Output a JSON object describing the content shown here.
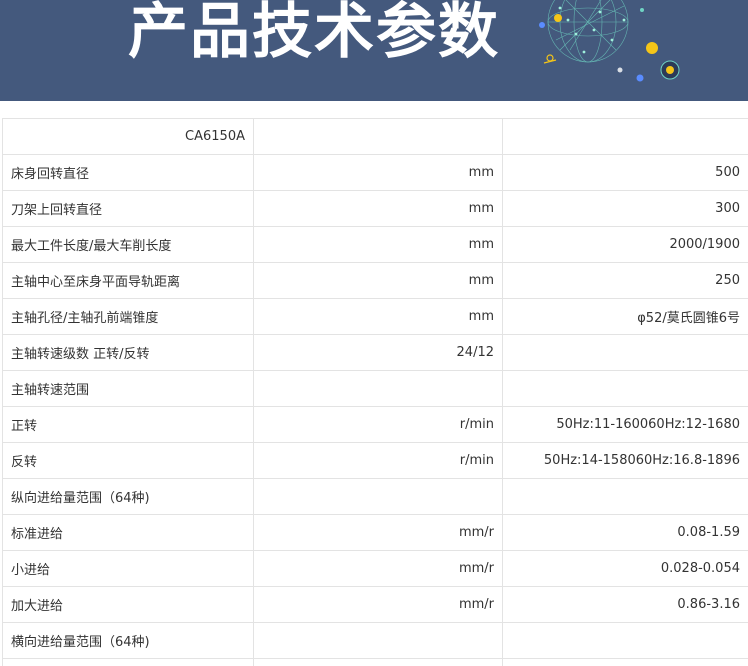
{
  "banner": {
    "title": "产品技术参数",
    "background": "#44597d"
  },
  "spec_table": {
    "rows": [
      {
        "name": "CA6150A",
        "unit": "",
        "value": ""
      },
      {
        "name": "床身回转直径",
        "unit": "mm",
        "value": "500"
      },
      {
        "name": "刀架上回转直径",
        "unit": "mm",
        "value": "300"
      },
      {
        "name": "最大工件长度/最大车削长度",
        "unit": "mm",
        "value": "2000/1900"
      },
      {
        "name": "主轴中心至床身平面导轨距离",
        "unit": "mm",
        "value": "250"
      },
      {
        "name": "主轴孔径/主轴孔前端锥度",
        "unit": "mm",
        "value": "φ52/莫氏圆锥6号"
      },
      {
        "name": "主轴转速级数 正转/反转",
        "unit": "24/12",
        "value": ""
      },
      {
        "name": "主轴转速范围",
        "unit": "",
        "value": ""
      },
      {
        "name": "正转",
        "unit": "r/min",
        "value": "50Hz:11-160060Hz:12-1680"
      },
      {
        "name": "反转",
        "unit": "r/min",
        "value": "50Hz:14-158060Hz:16.8-1896"
      },
      {
        "name": "纵向进给量范围（64种)",
        "unit": "",
        "value": ""
      },
      {
        "name": "标准进给",
        "unit": "mm/r",
        "value": "0.08-1.59"
      },
      {
        "name": "小进给",
        "unit": "mm/r",
        "value": "0.028-0.054"
      },
      {
        "name": "加大进给",
        "unit": "mm/r",
        "value": "0.86-3.16"
      },
      {
        "name": "横向进给量范围（64种)",
        "unit": "",
        "value": ""
      },
      {
        "name": "",
        "unit": "",
        "value": ""
      }
    ]
  }
}
